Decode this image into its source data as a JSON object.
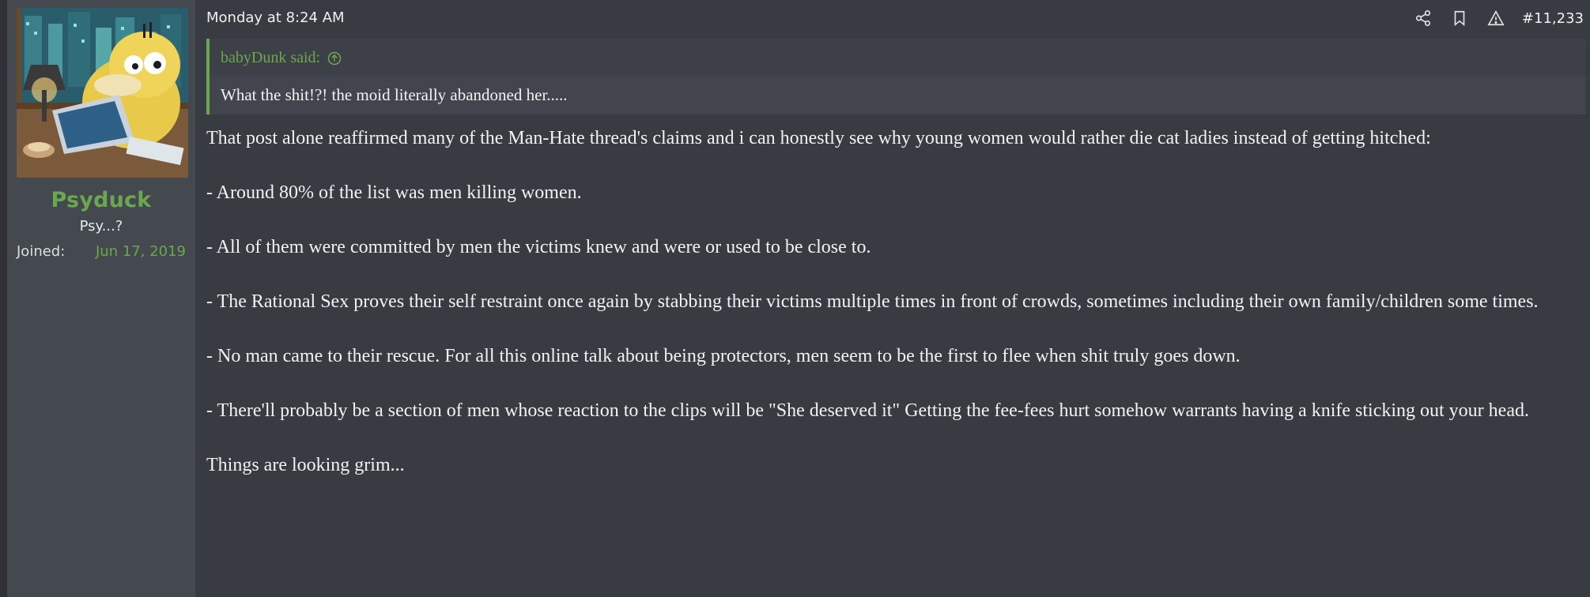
{
  "post": {
    "timestamp": "Monday at 8:24 AM",
    "post_number": "#11,233",
    "author": {
      "name": "Psyduck",
      "title": "Psy...?",
      "joined_label": "Joined:",
      "joined_value": "Jun 17, 2019"
    },
    "quote": {
      "author": "babyDunk said:",
      "text": "What the shit!?! the moid literally abandoned her....."
    },
    "paragraphs": [
      "That post alone reaffirmed many of the Man-Hate thread's claims and i can honestly see why young women would rather die cat ladies instead of getting hitched:",
      "- Around 80% of the list was men killing women.",
      "- All of them were committed by men the victims knew and were or used to be close to.",
      "- The Rational Sex proves their self restraint once again by stabbing their victims multiple times in front of crowds, sometimes including their own family/children some times.",
      "- No man came to their rescue. For all this online talk about being protectors, men seem to be the first to flee when shit truly goes down.",
      "- There'll probably be a section of men whose reaction to the clips will be \"She deserved it\" Getting the fee-fees hurt somehow warrants having a knife sticking out your head.",
      "Things are looking grim..."
    ]
  },
  "icons": {
    "share": "share-icon",
    "bookmark": "bookmark-icon",
    "report": "warning-icon",
    "quote_jump": "arrow-up-circle-icon",
    "avatar": "duck-at-laptop-avatar"
  },
  "colors": {
    "accent_green": "#6aa84f",
    "panel_bg": "#44494f",
    "content_bg": "#393b43",
    "quote_bg": "#42454d"
  }
}
